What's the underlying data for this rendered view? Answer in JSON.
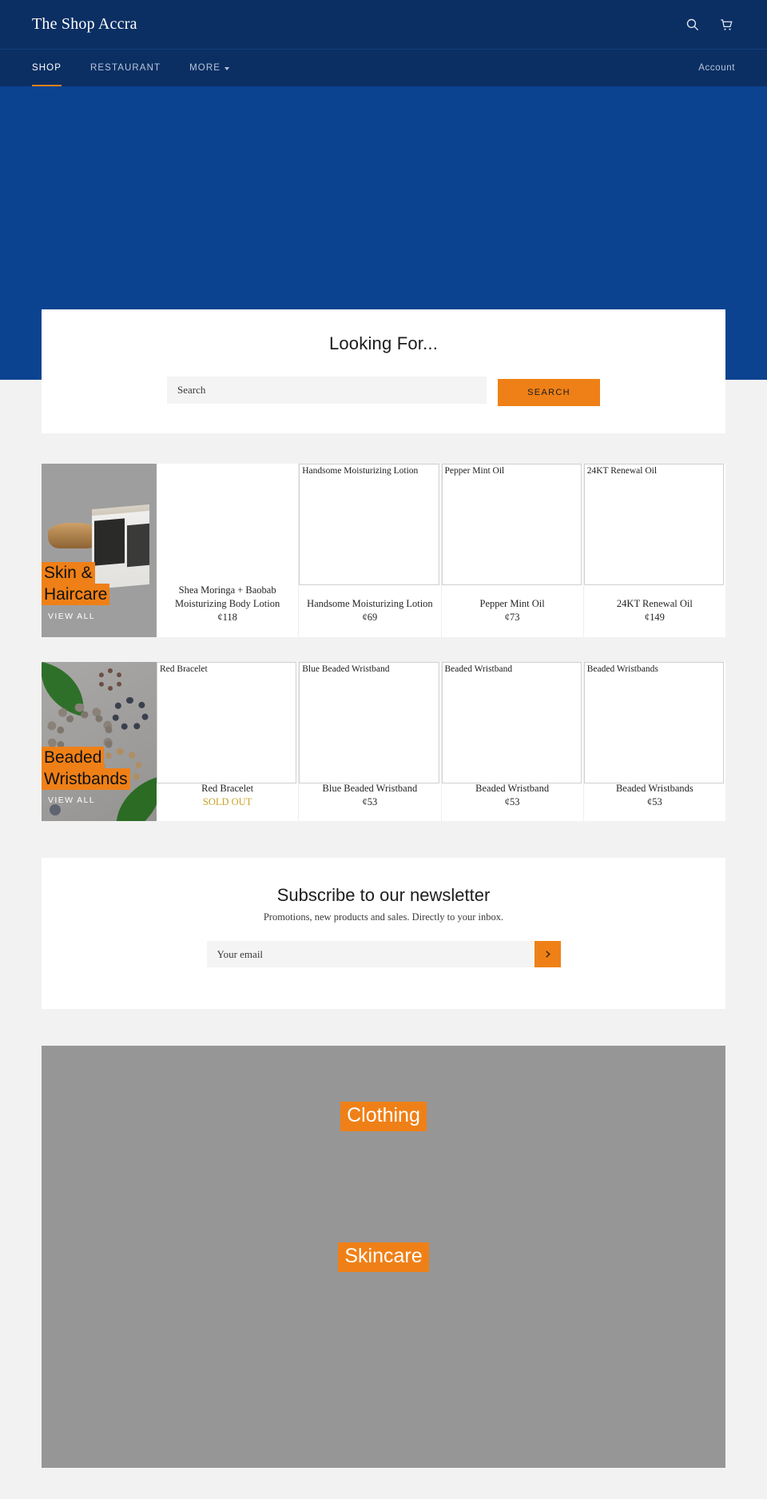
{
  "header": {
    "brand": "The Shop Accra",
    "search_icon": "search-icon",
    "cart_icon": "cart-icon"
  },
  "nav": {
    "items": [
      {
        "label": "SHOP",
        "active": true,
        "has_caret": false
      },
      {
        "label": "RESTAURANT",
        "active": false,
        "has_caret": false
      },
      {
        "label": "MORE",
        "active": false,
        "has_caret": true
      }
    ],
    "account_label": "Account"
  },
  "hero": {
    "background_color": "#0b4391"
  },
  "search_section": {
    "title": "Looking For...",
    "input_placeholder": "Search",
    "input_value": "",
    "button_label": "SEARCH",
    "button_color": "#ef8017"
  },
  "collections": [
    {
      "tile_title_lines": [
        "Skin &",
        "Haircare"
      ],
      "view_all_label": "VIEW ALL",
      "products": [
        {
          "alt": "",
          "name": "Shea Moringa + Baobab Moisturizing Body Lotion",
          "price": "¢118",
          "sold_out": false,
          "show_border": false
        },
        {
          "alt": "Handsome Moisturizing Lotion",
          "name": "Handsome Moisturizing Lotion",
          "price": "¢69",
          "sold_out": false,
          "show_border": true
        },
        {
          "alt": "Pepper Mint Oil",
          "name": "Pepper Mint Oil",
          "price": "¢73",
          "sold_out": false,
          "show_border": true
        },
        {
          "alt": "24KT Renewal Oil",
          "name": "24KT Renewal Oil",
          "price": "¢149",
          "sold_out": false,
          "show_border": true
        }
      ]
    },
    {
      "tile_title_lines": [
        "Beaded",
        "Wristbands"
      ],
      "view_all_label": "VIEW ALL",
      "products": [
        {
          "alt": "Red Bracelet",
          "name": "Red Bracelet",
          "price": "SOLD OUT",
          "sold_out": true,
          "show_border": true
        },
        {
          "alt": "Blue Beaded Wristband",
          "name": "Blue Beaded Wristband",
          "price": "¢53",
          "sold_out": false,
          "show_border": true
        },
        {
          "alt": "Beaded Wristband",
          "name": "Beaded Wristband",
          "price": "¢53",
          "sold_out": false,
          "show_border": true
        },
        {
          "alt": "Beaded Wristbands",
          "name": "Beaded Wristbands",
          "price": "¢53",
          "sold_out": false,
          "show_border": true
        }
      ]
    }
  ],
  "newsletter": {
    "title": "Subscribe to our newsletter",
    "subtitle": "Promotions, new products and sales. Directly to your inbox.",
    "input_placeholder": "Your email",
    "input_value": "",
    "submit_icon": "chevron-right-icon",
    "submit_color": "#ef8017"
  },
  "categories": [
    {
      "label": "Clothing"
    },
    {
      "label": "Skincare"
    }
  ],
  "colors": {
    "header_blue": "#0b2f63",
    "hero_blue": "#0b4391",
    "accent_orange": "#ef8017",
    "page_bg": "#f2f2f2",
    "sold_out": "#c9a227"
  }
}
